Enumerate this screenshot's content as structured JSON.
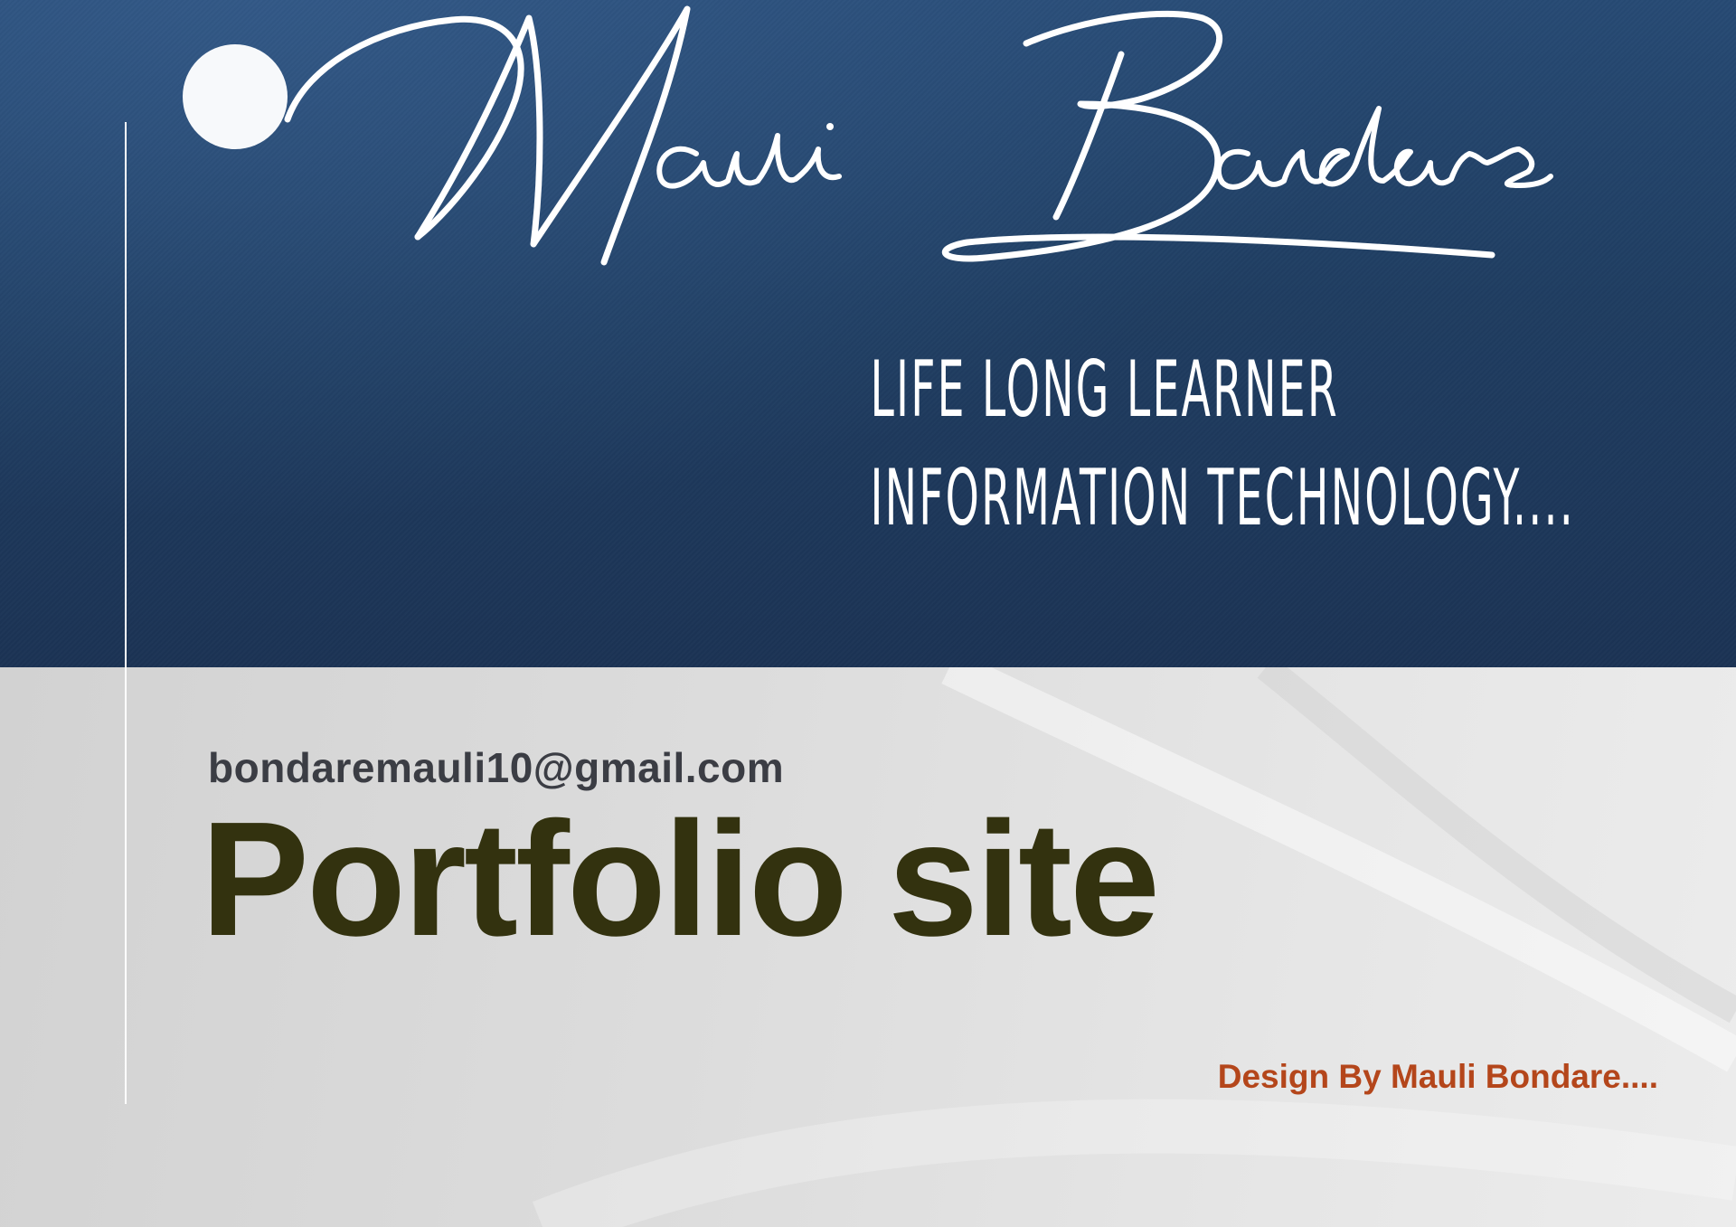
{
  "logo": {
    "signature_text": "Mauli Bondare",
    "tagline_lines": [
      "LIFE LONG LEARNER",
      "INFORMATION TECHNOLOGY...."
    ]
  },
  "contact": {
    "email": "bondaremauli10@gmail.com"
  },
  "title": "Portfolio site",
  "credit": "Design By Mauli Bondare....",
  "colors": {
    "hero_navy": "#1f3d61",
    "title": "#33320f",
    "email": "#3b3d44",
    "credit": "#b4461b"
  }
}
